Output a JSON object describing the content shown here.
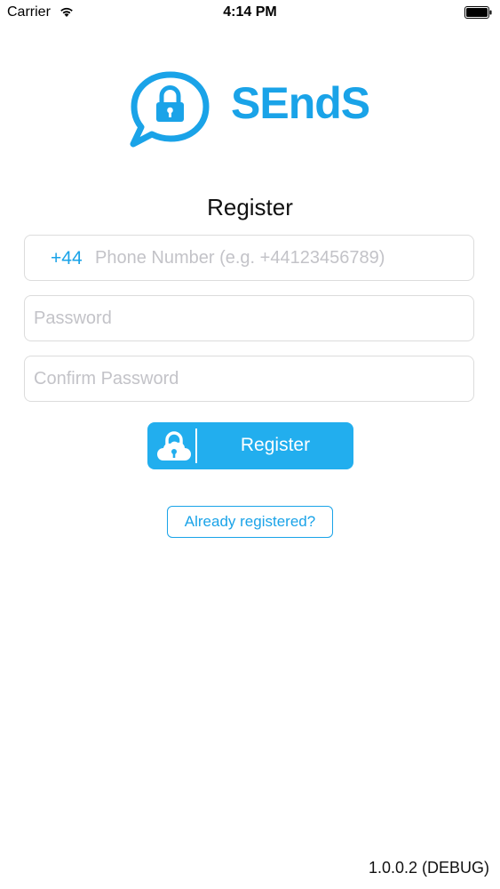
{
  "status_bar": {
    "carrier": "Carrier",
    "time": "4:14 PM",
    "icons": [
      "wifi-icon",
      "battery-icon"
    ]
  },
  "logo": {
    "text": "SEndS",
    "icon": "chat-lock-icon",
    "color": "#1aa3e8"
  },
  "form": {
    "title": "Register",
    "phone": {
      "prefix": "+44",
      "placeholder": "Phone Number (e.g. +44123456789)",
      "value": ""
    },
    "password": {
      "placeholder": "Password",
      "value": ""
    },
    "confirm_password": {
      "placeholder": "Confirm Password",
      "value": ""
    },
    "register_button": {
      "label": "Register",
      "icon": "cloud-lock-icon",
      "color": "#22aeee"
    },
    "already_registered": {
      "label": "Already registered?"
    }
  },
  "footer": {
    "version": "1.0.0.2 (DEBUG)"
  }
}
